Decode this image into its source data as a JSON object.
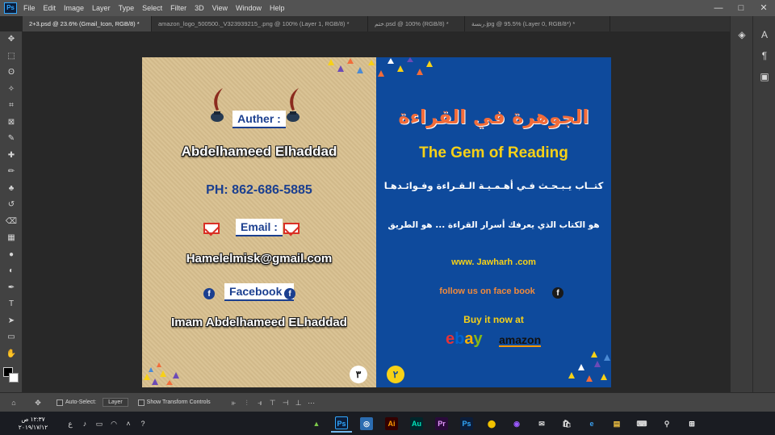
{
  "menubar": {
    "logo": "Ps",
    "items": [
      "File",
      "Edit",
      "Image",
      "Layer",
      "Type",
      "Select",
      "Filter",
      "3D",
      "View",
      "Window",
      "Help"
    ],
    "controls": [
      "—",
      "□",
      "✕"
    ]
  },
  "tabs": [
    {
      "label": "2+3.psd @ 23.6% (Gmail_Icon, RGB/8) *",
      "active": true
    },
    {
      "label": "amazon_logo_500500._V323939215_.png @ 100% (Layer 1, RGB/8) *",
      "active": false
    },
    {
      "label": "ختم.psd @ 100% (RGB/8) *",
      "active": false
    },
    {
      "label": "ربسة.jpg @ 95.5% (Layer 0, RGB/8*) *",
      "active": false
    }
  ],
  "tools": [
    "move-icon",
    "marquee-icon",
    "lasso-icon",
    "magic-wand-icon",
    "crop-icon",
    "frame-icon",
    "eyedropper-icon",
    "healing-icon",
    "brush-icon",
    "stamp-icon",
    "history-brush-icon",
    "eraser-icon",
    "gradient-icon",
    "blur-icon",
    "dodge-icon",
    "pen-icon",
    "type-icon",
    "path-select-icon",
    "rectangle-icon",
    "hand-icon",
    "zoom-icon"
  ],
  "tool_glyphs": [
    "✥",
    "⬚",
    "ʘ",
    "✧",
    "⌗",
    "⊠",
    "✎",
    "✚",
    "✏",
    "♣",
    "↺",
    "⌫",
    "▦",
    "●",
    "◐",
    "✒",
    "T",
    "➤",
    "▭",
    "✋",
    "⚲"
  ],
  "dock": {
    "col1": [
      "layers-icon"
    ],
    "col1_glyphs": [
      "◈"
    ],
    "col2": [
      "character-icon",
      "paragraph-icon",
      "swatches-icon",
      "libraries-icon"
    ],
    "col2_glyphs": [
      "A",
      "¶",
      "▣",
      "▤"
    ]
  },
  "card": {
    "left": {
      "author_label": "Auther :",
      "author_name": "Abdelhameed Elhaddad",
      "phone": "PH: 862-686-5885",
      "email_label": "Email :",
      "email": "Hamelelmisk@gmail.com",
      "facebook_label": "Facebook :",
      "facebook_name": "Imam Abdelhameed ELhaddad",
      "page_number": "٣"
    },
    "right": {
      "arabic_title": "الجوهرة في القراءة",
      "english_title": "The Gem of Reading",
      "tagline1": "كتــاب يـبـحـث فـي أهـمـيـة الـقـراءة وفـوائـدهـا",
      "tagline2": "هو الكتاب الذي يعرفك أسرار القراءة ... هو الطريق",
      "website": "www. Jawharh .com",
      "follow": "follow us on face book",
      "buy": "Buy it now at",
      "store1": "ebay",
      "store2": "amazon",
      "page_number": "٢"
    }
  },
  "options": {
    "auto_select": "Auto-Select:",
    "layer": "Layer",
    "transform": "Show Transform Controls"
  },
  "taskbar": {
    "time": "١٢:٣٧ ص",
    "date": "٢٠١٩/١٧/١٢",
    "lang": "ع",
    "apps": [
      "Ps",
      "◎",
      "Ai",
      "Au",
      "Pr",
      "Ps",
      "⬤",
      "◉",
      "✉",
      "🛍",
      "e",
      "▤",
      "⌨",
      "⚲",
      "⊞"
    ]
  },
  "colors": {
    "ps_blue": "#31a8ff",
    "card_navy": "#1b3f8f",
    "card_blue_bg": "#0e4a9c",
    "card_gold_bg": "#d8bf8e",
    "title_orange": "#f26c3a",
    "title_yellow": "#f7d117",
    "follow_orange": "#f08a3c"
  }
}
